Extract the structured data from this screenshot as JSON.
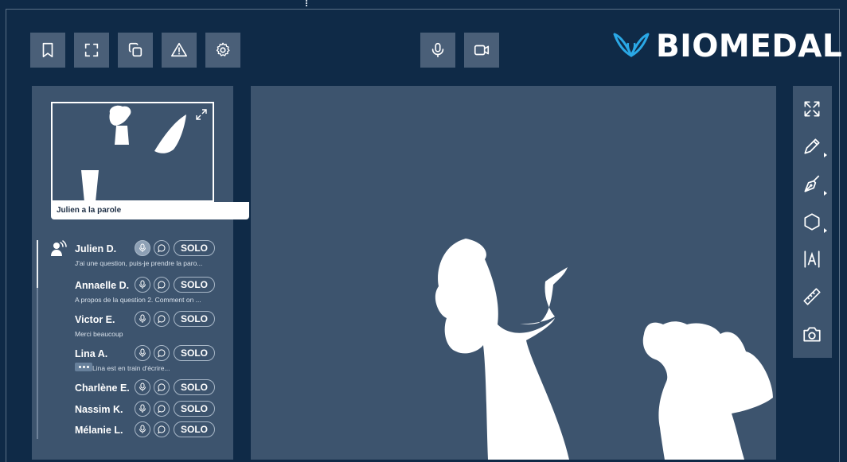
{
  "toolbar": {
    "left_buttons": [
      "bookmark-icon",
      "fullscreen-icon",
      "copy-icon",
      "warning-icon",
      "gear-icon"
    ],
    "center_buttons": [
      "microphone-icon",
      "video-camera-icon"
    ]
  },
  "brand": {
    "name": "BIOMEDAL",
    "accent": "#2aa8e6"
  },
  "preview": {
    "caption": "Julien a la parole"
  },
  "participants": [
    {
      "name": "Julien D.",
      "message": "J'ai une question, puis-je prendre la paro...",
      "mic_active": true,
      "solo": "SOLO",
      "speaking": true
    },
    {
      "name": "Annaelle D.",
      "message": "A propos de la question 2. Comment on ...",
      "mic_active": false,
      "solo": "SOLO"
    },
    {
      "name": "Victor E.",
      "message": "Merci beaucoup",
      "mic_active": false,
      "solo": "SOLO"
    },
    {
      "name": "Lina A.",
      "message": "Lina est en train d'écrire...",
      "mic_active": false,
      "solo": "SOLO",
      "typing": true
    },
    {
      "name": "Charlène E.",
      "message": "",
      "mic_active": false,
      "solo": "SOLO"
    },
    {
      "name": "Nassim K.",
      "message": "",
      "mic_active": false,
      "solo": "SOLO"
    },
    {
      "name": "Mélanie L.",
      "message": "",
      "mic_active": false,
      "solo": "SOLO"
    }
  ],
  "right_tools": [
    "expand-icon",
    "pencil-icon",
    "pen-nib-icon",
    "hexagon-icon",
    "text-tool-icon",
    "ruler-icon",
    "camera-icon"
  ],
  "colors": {
    "background": "#0f2a47",
    "panel": "#3d546e",
    "button": "#4a5f78"
  }
}
